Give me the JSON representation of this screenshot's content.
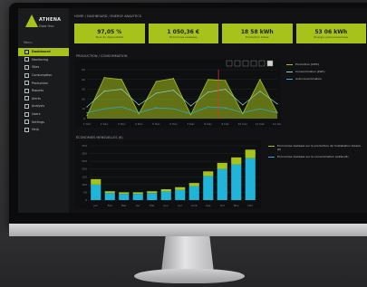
{
  "app": {
    "brand_name": "ATHENA",
    "brand_sub": "Data Hub",
    "top_title": "HOME / DASHBOARD / ENERGY ANALYTICS"
  },
  "sidebar": {
    "section_label": "Menu",
    "items": [
      {
        "label": "Dashboard",
        "icon": "grid-icon",
        "active": true
      },
      {
        "label": "Monitoring",
        "icon": "monitor-icon",
        "active": false
      },
      {
        "label": "Sites",
        "icon": "building-icon",
        "active": false
      },
      {
        "label": "Consumption",
        "icon": "bolt-icon",
        "active": false
      },
      {
        "label": "Production",
        "icon": "sun-icon",
        "active": false
      },
      {
        "label": "Reports",
        "icon": "file-icon",
        "active": false
      },
      {
        "label": "Alerts",
        "icon": "bell-icon",
        "active": false
      },
      {
        "label": "Analysis",
        "icon": "chart-icon",
        "active": false
      },
      {
        "label": "Users",
        "icon": "user-icon",
        "active": false
      },
      {
        "label": "Settings",
        "icon": "gear-icon",
        "active": false
      },
      {
        "label": "Help",
        "icon": "help-icon",
        "active": false
      }
    ]
  },
  "kpis": [
    {
      "value": "97,05 %",
      "label": "Taux de disponibilité"
    },
    {
      "value": "1 050,36 €",
      "label": "Économies réalisées"
    },
    {
      "value": "18 58 kWh",
      "label": "Production totale"
    },
    {
      "value": "53 06 kWh",
      "label": "Énergie autoconsommée"
    }
  ],
  "colors": {
    "accent": "#a8c21c",
    "cyan": "#1fb4d8",
    "navy": "#2a3d7a",
    "red": "#e2323a",
    "panel_bg": "#121214"
  },
  "line_chart": {
    "title": "PRODUCTION / CONSOMMATION",
    "toolbar_icons": [
      "zoom-icon",
      "pan-icon",
      "home-icon",
      "reset-icon",
      "download-icon",
      "menu-icon"
    ],
    "legend": [
      {
        "label": "Production (kWh)",
        "color": "#a8c21c"
      },
      {
        "label": "Consommation (kWh)",
        "color": "#8fd0c8"
      },
      {
        "label": "Autoconsommation",
        "color": "#1fb4d8"
      }
    ]
  },
  "chart_data": [
    {
      "type": "area",
      "x": [
        "1 Déc",
        "2 Déc",
        "3 Déc",
        "4 Déc",
        "5 Déc",
        "6 Déc",
        "7 Déc",
        "8 Déc",
        "9 Déc",
        "10 Déc",
        "11 Déc",
        "12 Déc"
      ],
      "series": [
        {
          "name": "Production (kWh)",
          "values": [
            3,
            42,
            40,
            5,
            38,
            41,
            4,
            40,
            39,
            5,
            40,
            6
          ]
        },
        {
          "name": "Consommation (kWh)",
          "values": [
            12,
            28,
            30,
            14,
            26,
            29,
            13,
            27,
            30,
            14,
            28,
            15
          ]
        },
        {
          "name": "Autoconsommation",
          "values": [
            6,
            10,
            12,
            6,
            11,
            10,
            5,
            12,
            11,
            6,
            10,
            6
          ]
        }
      ],
      "ylim": [
        0,
        50
      ],
      "grid": true
    },
    {
      "type": "bar",
      "title": "ÉCONOMIES MENSUELLES (€)",
      "categories": [
        "Jan",
        "Fév",
        "Mar",
        "Avr",
        "Mai",
        "Juin",
        "Juil",
        "Août",
        "Sep",
        "Oct",
        "Nov",
        "Déc"
      ],
      "series": [
        {
          "name": "Économies réalisées sur la production de l'installation Solaire (€)",
          "values": [
            100,
            45,
            40,
            40,
            45,
            55,
            65,
            90,
            155,
            200,
            230,
            270
          ]
        },
        {
          "name": "Économies réalisées sur la consommation évitée (€)",
          "values": [
            35,
            12,
            10,
            10,
            12,
            15,
            18,
            20,
            30,
            40,
            45,
            55
          ]
        }
      ],
      "ylim": [
        0,
        350
      ],
      "yticks": [
        0,
        50,
        100,
        150,
        200,
        250,
        300,
        350
      ],
      "grid": true
    }
  ]
}
